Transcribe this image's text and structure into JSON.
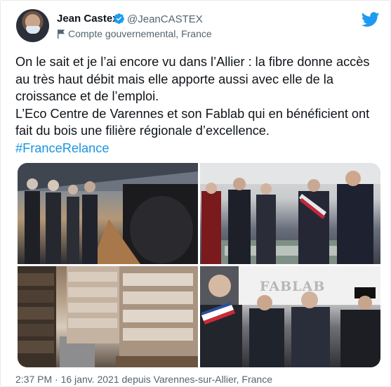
{
  "author": {
    "name": "Jean Castex",
    "handle": "@JeanCASTEX",
    "account_label": "Compte gouvernemental, France",
    "avatar_icon": "profile-photo"
  },
  "icons": {
    "verified": "verified-badge-icon",
    "government": "government-flag-icon",
    "platform": "twitter-bird-icon"
  },
  "colors": {
    "accent": "#1d9bf0",
    "hashtag": "#1b95e0",
    "muted": "#536471",
    "text": "#0f1419"
  },
  "tweet": {
    "line1": "On le sait et je l’ai encore vu dans l’Allier : la fibre donne accès au très haut débit mais elle apporte aussi avec elle de la croissance et de l’emploi.",
    "line2": "L’Eco Centre de Varennes et son Fablab qui en bénéficient ont fait du bois une filière régionale d’excellence.",
    "hashtag": "#FranceRelance"
  },
  "photos": [
    {
      "description_icon": "photo-warehouse-visit"
    },
    {
      "description_icon": "photo-model-inspection"
    },
    {
      "description_icon": "photo-wood-pellet-bags"
    },
    {
      "description_icon": "photo-fablab-group",
      "sign_text": "FABLAB"
    }
  ],
  "footer": {
    "timestamp_line": "2:37 PM · 16 janv. 2021 depuis Varennes-sur-Allier, France"
  }
}
